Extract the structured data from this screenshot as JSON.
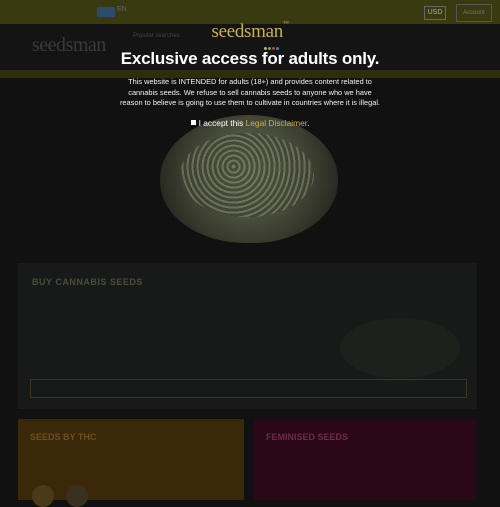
{
  "colors": {
    "brand_gold": "#c9b24e",
    "overlay_text": "#ffffff",
    "logo_dot_1": "#c9b24e",
    "logo_dot_2": "#7aa83a",
    "logo_dot_3": "#c7354d",
    "logo_dot_4": "#3a7dc9"
  },
  "background_page": {
    "top_bar": {
      "flag_icon": "flag-icon",
      "language_label": "EN",
      "currency_label": "USD",
      "account_label": "Account"
    },
    "header": {
      "logo_text": "seedsman",
      "nav_text": "Popular searches"
    },
    "buy_section": {
      "title": "BUY CANNABIS SEEDS"
    },
    "card_left": {
      "title": "SEEDS BY THC"
    },
    "card_right": {
      "title": "FEMINISED SEEDS"
    }
  },
  "age_gate": {
    "logo_text": "seedsman",
    "logo_trademark": "™",
    "title": "Exclusive access for adults only.",
    "body": "This website is INTENDED for adults (18+) and provides content related to cannabis seeds. We refuse to sell cannabis seeds to anyone who we have reason to believe is going to use them to cultivate in countries where it is illegal.",
    "accept_prefix": "I accept this ",
    "accept_link": "Legal Disclaimer",
    "accept_suffix": "."
  }
}
